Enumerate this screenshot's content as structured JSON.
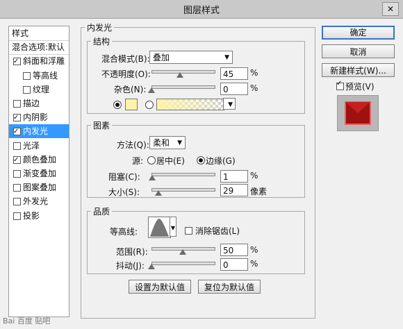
{
  "window": {
    "title": "图层样式",
    "close_label": "✕"
  },
  "left_panel": {
    "items": [
      {
        "label": "样式",
        "checkbox": false,
        "checked": false,
        "indent": 0
      },
      {
        "label": "混合选项:默认",
        "checkbox": false,
        "checked": false,
        "indent": 0
      },
      {
        "label": "斜面和浮雕",
        "checkbox": true,
        "checked": true,
        "indent": 0
      },
      {
        "label": "等高线",
        "checkbox": true,
        "checked": false,
        "indent": 1
      },
      {
        "label": "纹理",
        "checkbox": true,
        "checked": false,
        "indent": 1
      },
      {
        "label": "描边",
        "checkbox": true,
        "checked": false,
        "indent": 0
      },
      {
        "label": "内阴影",
        "checkbox": true,
        "checked": true,
        "indent": 0
      },
      {
        "label": "内发光",
        "checkbox": true,
        "checked": true,
        "indent": 0,
        "selected": true
      },
      {
        "label": "光泽",
        "checkbox": true,
        "checked": false,
        "indent": 0
      },
      {
        "label": "颜色叠加",
        "checkbox": true,
        "checked": true,
        "indent": 0
      },
      {
        "label": "渐变叠加",
        "checkbox": true,
        "checked": false,
        "indent": 0
      },
      {
        "label": "图案叠加",
        "checkbox": true,
        "checked": false,
        "indent": 0
      },
      {
        "label": "外发光",
        "checkbox": true,
        "checked": false,
        "indent": 0
      },
      {
        "label": "投影",
        "checkbox": true,
        "checked": false,
        "indent": 0
      }
    ]
  },
  "inner_glow": {
    "title": "内发光",
    "structure": {
      "title": "结构",
      "blend_mode_label": "混合模式(B):",
      "blend_mode_value": "叠加",
      "opacity_label": "不透明度(O):",
      "opacity_value": "45",
      "opacity_level": 0.45,
      "noise_label": "杂色(N):",
      "noise_value": "0",
      "noise_level": 0,
      "percent": "%"
    },
    "elements": {
      "title": "图素",
      "technique_label": "方法(Q):",
      "technique_value": "柔和",
      "source_label": "源:",
      "source_center": "居中(E)",
      "source_edge": "边缘(G)",
      "choke_label": "阻塞(C):",
      "choke_value": "1",
      "choke_level": 0.01,
      "size_label": "大小(S):",
      "size_value": "29",
      "size_level": 0.116,
      "pixels": "像素",
      "percent": "%"
    },
    "quality": {
      "title": "品质",
      "contour_label": "等高线:",
      "anti_alias_label": "消除锯齿(L)",
      "range_label": "范围(R):",
      "range_value": "50",
      "range_level": 0.5,
      "jitter_label": "抖动(J):",
      "jitter_value": "0",
      "jitter_level": 0,
      "percent": "%"
    },
    "make_default": "设置为默认值",
    "reset_default": "复位为默认值"
  },
  "buttons": {
    "ok": "确定",
    "cancel": "取消",
    "new_style": "新建样式(W)...",
    "preview": "预览(V)"
  },
  "colors": {
    "glow_swatch": "#fff3a8",
    "selected": "#3399ff",
    "preview_red": "#b01818"
  }
}
